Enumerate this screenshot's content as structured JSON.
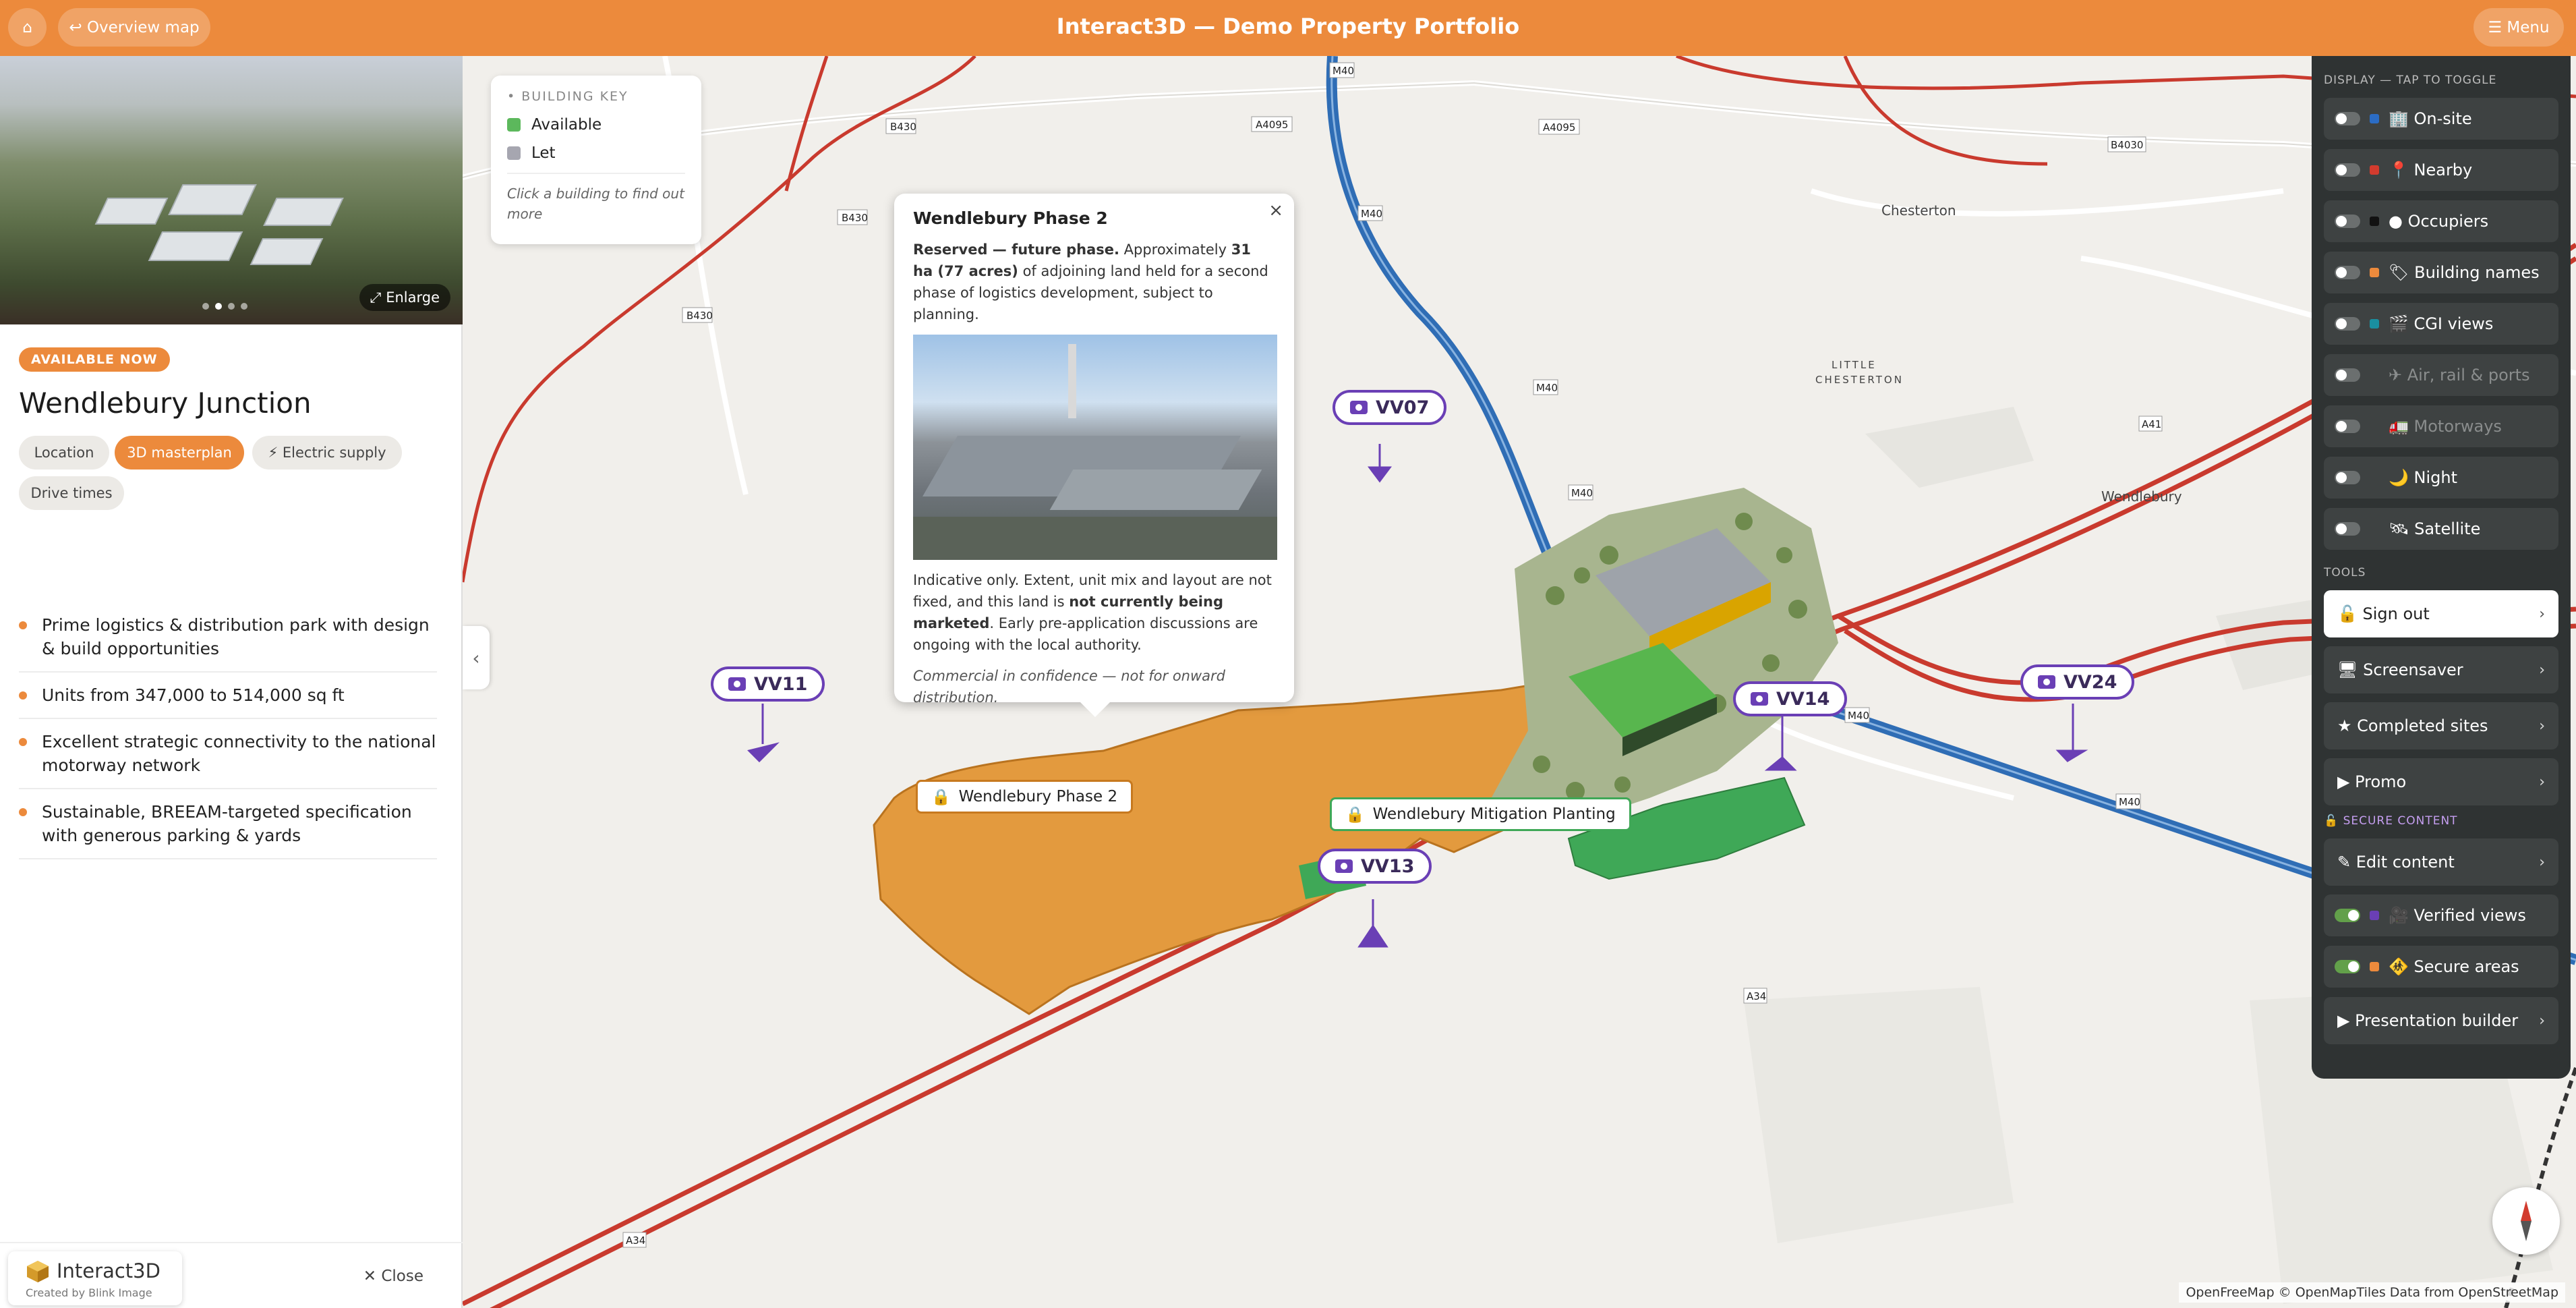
{
  "header": {
    "title": "Interact3D — Demo Property Portfolio",
    "home_icon": "⌂",
    "overview_label": "↩ Overview map",
    "menu_label": "☰ Menu",
    "accent": "#ec8a3c"
  },
  "left_panel": {
    "enlarge_label": "⤢ Enlarge",
    "badge": "AVAILABLE NOW",
    "title": "Wendlebury Junction",
    "tabs": [
      {
        "label": "Location",
        "active": false
      },
      {
        "label": "3D masterplan",
        "active": true
      },
      {
        "label": "⚡ Electric supply",
        "active": false
      },
      {
        "label": "Drive times",
        "active": false
      }
    ],
    "bullets": [
      "Prime logistics & distribution park with design & build opportunities",
      "Units from 347,000 to 514,000 sq ft",
      "Excellent strategic connectivity to the national motorway network",
      "Sustainable, BREEAM-targeted specification with generous parking & yards"
    ],
    "brand_name": "Interact3D",
    "brand_sub": "Created by Blink Image",
    "close_label": "✕ Close",
    "collapse_icon": "‹"
  },
  "building_key": {
    "title": "• BUILDING KEY",
    "items": [
      {
        "label": "Available",
        "color": "#5cb85c"
      },
      {
        "label": "Let",
        "color": "#a6a6b0"
      }
    ],
    "hint": "Click a building to find out more"
  },
  "popup": {
    "title": "Wendlebury Phase 2",
    "close": "×",
    "lead_bold": "Reserved — future phase.",
    "lead_text1": " Approximately ",
    "lead_bold2": "31 ha (77 acres)",
    "lead_text2": " of adjoining land held for a second phase of logistics development, subject to planning.",
    "p2_text1": "Indicative only. Extent, unit mix and layout are not fixed, and this land is ",
    "p2_bold": "not currently being marketed",
    "p2_text2": ". Early pre-application discussions are ongoing with the local authority.",
    "note": "Commercial in confidence — not for onward distribution."
  },
  "map": {
    "markers": [
      "VV07",
      "VV11",
      "VV13",
      "VV14",
      "VV24"
    ],
    "phase2_label": "Wendlebury Phase 2",
    "mitigation_label": "Wendlebury Mitigation Planting",
    "lock_icon": "🔒",
    "places": [
      "Chesterton",
      "LITTLE",
      "CHESTERTON",
      "Wendlebury"
    ],
    "roads": [
      "B430",
      "A4095",
      "M40",
      "B4030",
      "A41",
      "A34"
    ],
    "attribution": "OpenFreeMap © OpenMapTiles Data from OpenStreetMap",
    "phase2_color": "#e39a3e",
    "motorway_color": "#2f6db5",
    "primary_road_color": "#c93a2e"
  },
  "right_panel": {
    "display_head": "DISPLAY — TAP TO TOGGLE",
    "toggles": [
      {
        "label": "🏢 On-site",
        "on": false,
        "color": "#2b6cc4",
        "dim": false
      },
      {
        "label": "📍 Nearby",
        "on": false,
        "color": "#d23b2e",
        "dim": false
      },
      {
        "label": "● Occupiers",
        "on": false,
        "color": "#111111",
        "dim": false
      },
      {
        "label": "🏷 Building names",
        "on": false,
        "color": "#ec8a3c",
        "dim": false
      },
      {
        "label": "🎬 CGI views",
        "on": false,
        "color": "#1a8fa0",
        "dim": false
      },
      {
        "label": "✈ Air, rail & ports",
        "on": false,
        "color": "",
        "dim": true
      },
      {
        "label": "🚛 Motorways",
        "on": false,
        "color": "",
        "dim": true
      },
      {
        "label": "🌙 Night",
        "on": false,
        "color": "",
        "dim": false
      },
      {
        "label": "🛰 Satellite",
        "on": false,
        "color": "",
        "dim": false
      }
    ],
    "tools_head": "TOOLS",
    "tools": [
      {
        "label": "🔓 Sign out",
        "light": true
      },
      {
        "label": "🖥 Screensaver",
        "light": false
      },
      {
        "label": "★ Completed sites",
        "light": false
      },
      {
        "label": "▶ Promo",
        "light": false
      }
    ],
    "secure_head": "🔓 SECURE CONTENT",
    "secure_tools": [
      {
        "label": "✎ Edit content"
      }
    ],
    "secure_toggles": [
      {
        "label": "🎥 Verified views",
        "on": true,
        "color": "#6a3fb5"
      },
      {
        "label": "🚸 Secure areas",
        "on": true,
        "color": "#ec8a3c"
      }
    ],
    "builder": {
      "label": "▶ Presentation builder"
    },
    "chevron": "›"
  }
}
